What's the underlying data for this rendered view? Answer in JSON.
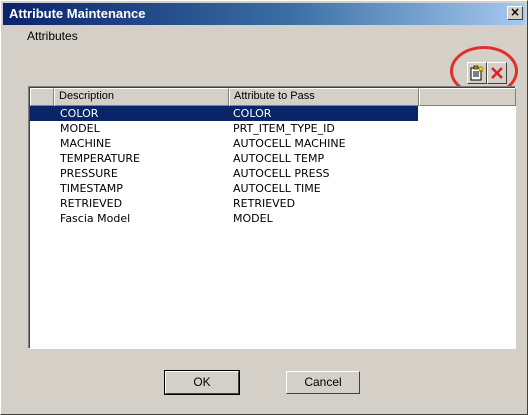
{
  "window": {
    "title": "Attribute Maintenance",
    "close_glyph": "×"
  },
  "group": {
    "label": "Attributes"
  },
  "toolbar": {
    "new_icon": "new-record-icon",
    "delete_icon": "delete-x-icon",
    "highlight_color": "#e0302b"
  },
  "table": {
    "columns": [
      "Description",
      "Attribute to Pass"
    ],
    "rows": [
      {
        "description": "COLOR",
        "attribute": "COLOR",
        "selected": true
      },
      {
        "description": "MODEL",
        "attribute": "PRT_ITEM_TYPE_ID"
      },
      {
        "description": "MACHINE",
        "attribute": "AUTOCELL MACHINE"
      },
      {
        "description": "TEMPERATURE",
        "attribute": "AUTOCELL TEMP"
      },
      {
        "description": "PRESSURE",
        "attribute": "AUTOCELL PRESS"
      },
      {
        "description": "TIMESTAMP",
        "attribute": "AUTOCELL TIME"
      },
      {
        "description": "RETRIEVED",
        "attribute": "RETRIEVED"
      },
      {
        "description": "Fascia Model",
        "attribute": "MODEL"
      }
    ]
  },
  "buttons": {
    "ok": "OK",
    "cancel": "Cancel"
  },
  "colors": {
    "selection": "#0a246a",
    "dialog_bg": "#d4d0c8",
    "title_start": "#0a246a"
  }
}
